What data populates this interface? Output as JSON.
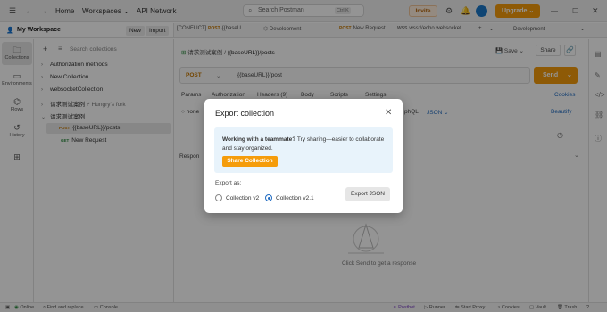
{
  "topbar": {
    "home": "Home",
    "workspaces": "Workspaces",
    "api_network": "API Network",
    "search_placeholder": "Search Postman",
    "search_shortcut": "Ctrl K",
    "invite": "Invite",
    "upgrade": "Upgrade"
  },
  "workspace": {
    "name": "My Workspace",
    "new": "New",
    "import": "Import"
  },
  "tabs": [
    {
      "label": "[CONFLICT]",
      "method": "POST",
      "name": "{{baseU"
    },
    {
      "label": "Development"
    },
    {
      "method": "POST",
      "name": "New Request"
    },
    {
      "method": "WSS",
      "name": "wss://echo.websocket"
    },
    {
      "label": "Development"
    }
  ],
  "rail": [
    {
      "label": "Collections"
    },
    {
      "label": "Environments"
    },
    {
      "label": "Flows"
    },
    {
      "label": "History"
    }
  ],
  "sidebar": {
    "search_placeholder": "Search collections",
    "items": [
      {
        "label": "Authorization methods"
      },
      {
        "label": "New Collection"
      },
      {
        "label": "websocketCollection"
      },
      {
        "label": "请求测试案例",
        "suffix": "Hungry's fork"
      },
      {
        "label": "请求测试案例"
      },
      {
        "method": "POST",
        "label": "{{baseURL}}/posts"
      },
      {
        "method": "GET",
        "label": "New Request"
      }
    ]
  },
  "request": {
    "breadcrumb_collection": "请求测试案例",
    "breadcrumb_name": "{{baseURL}}/posts",
    "save": "Save",
    "share": "Share",
    "method": "POST",
    "url": "{{baseURL}}/post",
    "send": "Send",
    "tabs": [
      "Params",
      "Authorization",
      "Headers (9)",
      "Body",
      "Scripts",
      "Settings"
    ],
    "cookies": "Cookies",
    "body_none": "none",
    "body_graphql": "phQL",
    "body_json": "JSON",
    "beautify": "Beautify",
    "response": "Respon",
    "empty_hint": "Click Send to get a response"
  },
  "modal": {
    "title": "Export collection",
    "info_bold": "Working with a teammate?",
    "info_text": " Try sharing—easier to collaborate and stay organized.",
    "share_button": "Share Collection",
    "export_as": "Export as:",
    "options": [
      {
        "label": "Collection v2",
        "selected": false
      },
      {
        "label": "Collection v2.1",
        "selected": true
      }
    ],
    "export_button": "Export JSON"
  },
  "status": {
    "online": "Online",
    "find_replace": "Find and replace",
    "console": "Console",
    "postbot": "Postbot",
    "runner": "Runner",
    "start_proxy": "Start Proxy",
    "cookies": "Cookies",
    "vault": "Vault",
    "trash": "Trash"
  },
  "colors": {
    "accent": "#f59c0b",
    "link": "#1f6bc2",
    "info_bg": "#e8f3fb"
  }
}
